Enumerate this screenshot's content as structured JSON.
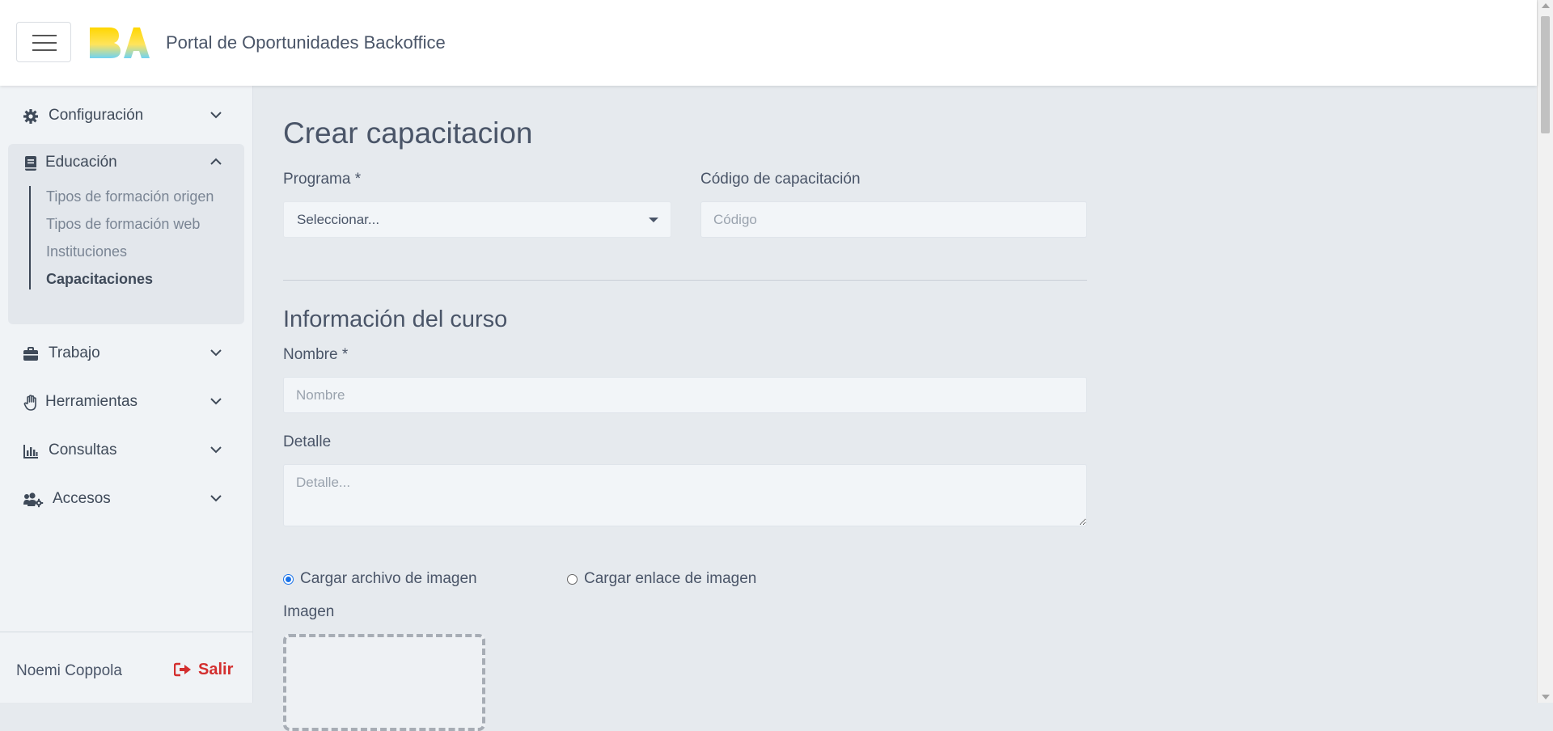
{
  "header": {
    "app_title": "Portal de Oportunidades Backoffice",
    "logo_text": "BA"
  },
  "sidebar": {
    "items": [
      {
        "label": "Configuración",
        "icon": "gear-icon",
        "expanded": false
      },
      {
        "label": "Educación",
        "icon": "book-icon",
        "expanded": true,
        "children": [
          {
            "label": "Tipos de formación origen"
          },
          {
            "label": "Tipos de formación web"
          },
          {
            "label": "Instituciones"
          },
          {
            "label": "Capacitaciones",
            "active": true
          }
        ]
      },
      {
        "label": "Trabajo",
        "icon": "briefcase-icon",
        "expanded": false
      },
      {
        "label": "Herramientas",
        "icon": "hand-icon",
        "expanded": false
      },
      {
        "label": "Consultas",
        "icon": "chart-icon",
        "expanded": false
      },
      {
        "label": "Accesos",
        "icon": "users-gear-icon",
        "expanded": false
      }
    ],
    "footer": {
      "user_name": "Noemi Coppola",
      "logout_label": "Salir"
    }
  },
  "main": {
    "title": "Crear capacitacion",
    "programa": {
      "label": "Programa *",
      "value": "Seleccionar..."
    },
    "codigo": {
      "label": "Código de capacitación",
      "placeholder": "Código",
      "value": ""
    },
    "section_title": "Información del curso",
    "nombre": {
      "label": "Nombre *",
      "placeholder": "Nombre",
      "value": ""
    },
    "detalle": {
      "label": "Detalle",
      "placeholder": "Detalle...",
      "value": ""
    },
    "image_source": {
      "options": [
        {
          "label": "Cargar archivo de imagen",
          "selected": true
        },
        {
          "label": "Cargar enlace de imagen",
          "selected": false
        }
      ]
    },
    "imagen": {
      "label": "Imagen"
    }
  },
  "colors": {
    "accent_blue": "#1a73e8",
    "logout_red": "#d32f2f",
    "sidebar_bg": "#f0f3f6",
    "main_bg": "#e6eaee",
    "logo_yellow": "#ffd600",
    "logo_cyan": "#6fd3f3"
  }
}
